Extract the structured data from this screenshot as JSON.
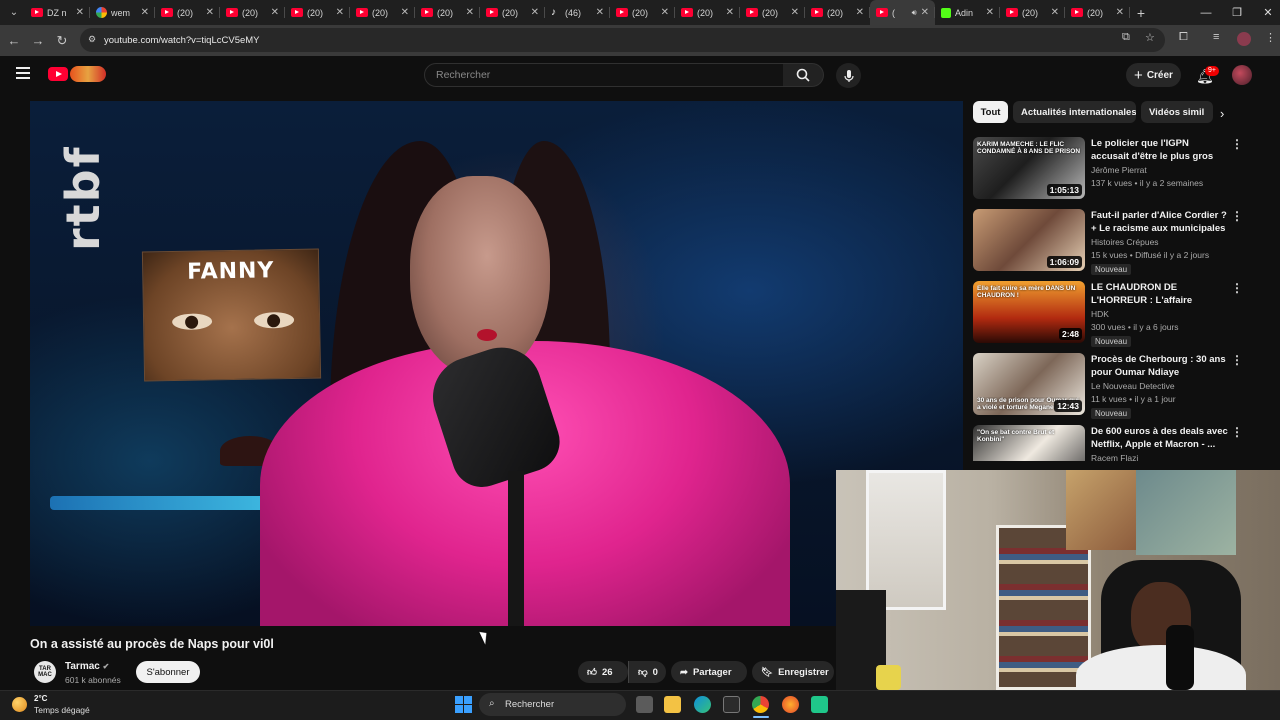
{
  "browser": {
    "tabs": [
      {
        "title": "DZ n",
        "icon": "youtube-icon"
      },
      {
        "title": "wem",
        "icon": "google-icon"
      },
      {
        "title": "(20)",
        "icon": "youtube-icon"
      },
      {
        "title": "(20)",
        "icon": "youtube-icon"
      },
      {
        "title": "(20)",
        "icon": "youtube-icon"
      },
      {
        "title": "(20)",
        "icon": "youtube-icon"
      },
      {
        "title": "(20)",
        "icon": "youtube-icon"
      },
      {
        "title": "(20)",
        "icon": "youtube-icon"
      },
      {
        "title": "(46)",
        "icon": "tiktok-icon"
      },
      {
        "title": "(20)",
        "icon": "youtube-icon"
      },
      {
        "title": "(20)",
        "icon": "youtube-icon"
      },
      {
        "title": "(20)",
        "icon": "youtube-icon"
      },
      {
        "title": "(20)",
        "icon": "youtube-icon"
      },
      {
        "title": "(",
        "icon": "youtube-icon",
        "active": true
      },
      {
        "title": "Adin",
        "icon": "kick-icon"
      },
      {
        "title": "(20)",
        "icon": "youtube-icon"
      },
      {
        "title": "(20)",
        "icon": "youtube-icon"
      }
    ],
    "url": "youtube.com/watch?v=tiqLcCV5eMY"
  },
  "youtube": {
    "search_placeholder": "Rechercher",
    "create_label": "Créer",
    "notif_count": "9+"
  },
  "video": {
    "overlay_logo": "rtbf",
    "overlay_name": "FANNY",
    "title": "On a assisté au procès de Naps pour vi0l",
    "channel": "Tarmac",
    "channel_avatar_text": "TAR MAC",
    "subscribers": "601 k abonnés",
    "subscribe_label": "S'abonner",
    "likes": "26",
    "dislikes": "0",
    "share_label": "Partager",
    "save_label": "Enregistrer"
  },
  "chips": [
    "Tout",
    "Actualités internationales",
    "Vidéos simil"
  ],
  "recommendations": [
    {
      "title": "Le policier que l'IGPN accusait d'être le plus gros trafiquant d...",
      "channel": "Jérôme Pierrat",
      "meta": "137 k vues • il y a 2 semaines",
      "duration": "1:05:13",
      "badge": "",
      "thumb_text": "KARIM MAMECHE : LE FLIC CONDAMNÉ À 8 ANS DE PRISON"
    },
    {
      "title": "Faut-il parler d'Alice Cordier ? + Le racisme aux municipales",
      "channel": "Histoires Crépues",
      "meta": "15 k vues • Diffusé il y a 2 jours",
      "duration": "1:06:09",
      "badge": "Nouveau",
      "thumb_text": ""
    },
    {
      "title": "LE CHAUDRON DE L'HORREUR : L'affaire Torilena May Fields ...",
      "channel": "HDK",
      "meta": "300 vues • il y a 6 jours",
      "duration": "2:48",
      "badge": "Nouveau",
      "thumb_text": "Elle fait cuire sa mère DANS UN CHAUDRON !"
    },
    {
      "title": "Procès de Cherbourg : 30 ans pour Oumar Ndiaye",
      "channel": "Le Nouveau Detective",
      "meta": "11 k vues • il y a 1 jour",
      "duration": "12:43",
      "badge": "Nouveau",
      "thumb_text": "30 ans de prison pour Oumar qui a violé et torturé Megane à"
    },
    {
      "title": "De 600 euros à des deals avec Netflix, Apple et Macron - ...",
      "channel": "Racem Flazi",
      "meta": "9,9 k vues • il y a 7 jours",
      "duration": "",
      "badge": "",
      "thumb_text": "\"On se bat contre Brut et Konbini\""
    }
  ],
  "taskbar": {
    "temperature": "2°C",
    "weather": "Temps dégagé",
    "search_label": "Rechercher"
  }
}
